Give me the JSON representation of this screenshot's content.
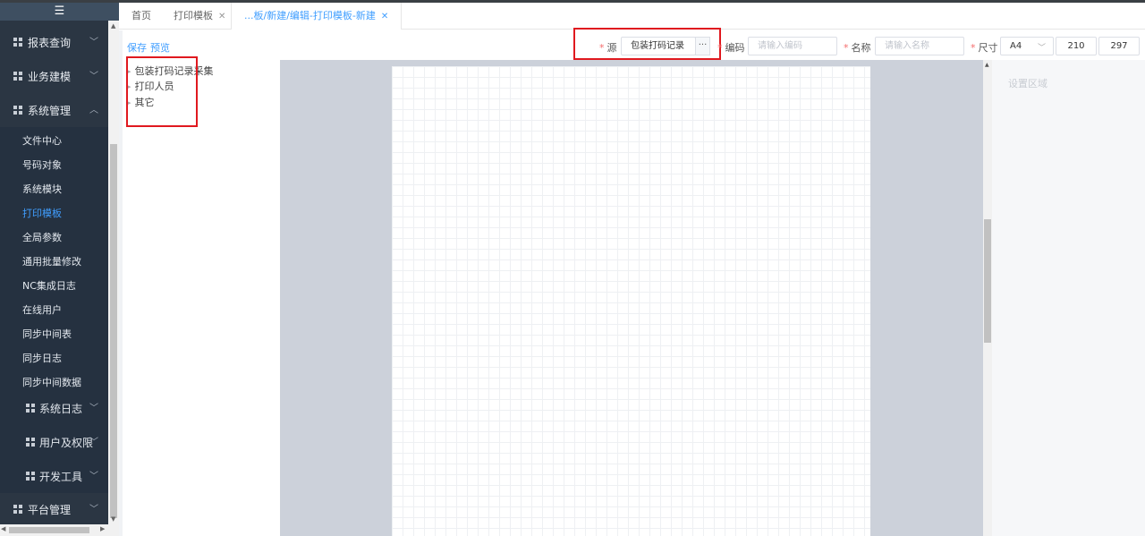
{
  "sidebar": {
    "hamburger": "☰",
    "menus": [
      {
        "label": "报表查询"
      },
      {
        "label": "业务建模"
      },
      {
        "label": "系统管理"
      }
    ],
    "sub_items": [
      {
        "label": "文件中心"
      },
      {
        "label": "号码对象"
      },
      {
        "label": "系统模块"
      },
      {
        "label": "打印模板"
      },
      {
        "label": "全局参数"
      },
      {
        "label": "通用批量修改"
      },
      {
        "label": "NC集成日志"
      },
      {
        "label": "在线用户"
      },
      {
        "label": "同步中间表"
      },
      {
        "label": "同步日志"
      },
      {
        "label": "同步中间数据"
      }
    ],
    "nested": [
      {
        "label": "系统日志"
      },
      {
        "label": "用户及权限"
      },
      {
        "label": "开发工具"
      }
    ],
    "bottom_menu": {
      "label": "平台管理"
    },
    "active_sub": "打印模板"
  },
  "tabs": [
    {
      "label": "首页",
      "closable": false
    },
    {
      "label": "打印模板",
      "closable": true
    },
    {
      "label": "...板/新建/编辑-打印模板-新建",
      "closable": true
    }
  ],
  "toolbar": {
    "save": "保存",
    "preview": "预览",
    "required_mark": "*",
    "source_label": "源",
    "source_value": "包装打码记录",
    "source_button": "···",
    "code_label": "编码",
    "code_placeholder": "请输入编码",
    "name_label": "名称",
    "name_placeholder": "请输入名称",
    "size_label": "尺寸",
    "size_value": "A4",
    "width_value": "210",
    "height_value": "297"
  },
  "tree": {
    "items": [
      {
        "label": "包装打码记录采集"
      },
      {
        "label": "打印人员"
      },
      {
        "label": "其它"
      }
    ]
  },
  "settings": {
    "title": "设置区域"
  },
  "colors": {
    "accent": "#409eff",
    "required": "#f56c6c",
    "highlight": "#e0191f",
    "sidebar_bg": "#2b3643"
  }
}
